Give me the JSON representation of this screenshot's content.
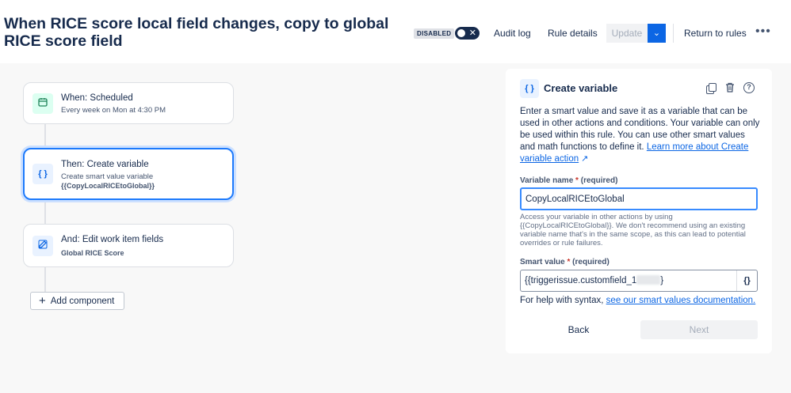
{
  "header": {
    "title": "When RICE score local field changes, copy to global RICE score field",
    "status": "DISABLED",
    "toggle_symbol": "✕",
    "audit_log": "Audit log",
    "rule_details": "Rule details",
    "update": "Update",
    "return_to_rules": "Return to rules",
    "more": "•••"
  },
  "nodes": [
    {
      "icon": "calendar-icon",
      "title": "When: Scheduled",
      "subtitle": "Every week on Mon at 4:30 PM"
    },
    {
      "icon": "braces-icon",
      "title": "Then: Create variable",
      "subtitle": "Create smart value variable",
      "detail": "{{CopyLocalRICEtoGlobal}}"
    },
    {
      "icon": "edit-icon",
      "title": "And: Edit work item fields",
      "detail": "Global RICE Score"
    }
  ],
  "add_component": "Add component",
  "panel": {
    "icon_text": "{ }",
    "title": "Create variable",
    "description": "Enter a smart value and save it as a variable that can be used in other actions and conditions. Your variable can only be used within this rule. You can use other smart values and math functions to define it.",
    "learn_more": "Learn more about Create variable action",
    "variable_name_label": "Variable name",
    "required_star": "*",
    "required_text": "(required)",
    "variable_name_value": "CopyLocalRICEtoGlobal",
    "variable_help": "Access your variable in other actions by using {{CopyLocalRICEtoGlobal}}. We don't recommend using an existing variable name that's in the same scope, as this can lead to potential overrides or rule failures.",
    "smart_value_label": "Smart value",
    "smart_value_prefix": "{{triggerissue.customfield_1",
    "smart_value_suffix": "}",
    "smart_button": "{}",
    "syntax_help_prefix": "For help with syntax,",
    "syntax_help_link": "see our smart values documentation.",
    "back": "Back",
    "next": "Next"
  },
  "colors": {
    "accent": "#0c66e4",
    "selected_border": "#1d7afc",
    "toggle": "#172b4d"
  }
}
